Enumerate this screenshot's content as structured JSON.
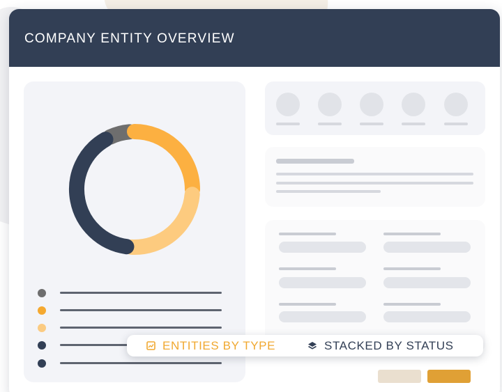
{
  "header": {
    "title": "COMPANY ENTITY OVERVIEW"
  },
  "chart": {
    "segments": [
      {
        "color": "#6e6e6e",
        "start_deg": 335,
        "end_deg": 355
      },
      {
        "color": "#fcb041",
        "start_deg": 0,
        "end_deg": 90
      },
      {
        "color": "#fdcb7f",
        "start_deg": 95,
        "end_deg": 183
      },
      {
        "color": "#323f55",
        "start_deg": 188,
        "end_deg": 330
      }
    ],
    "legend_colors": [
      "#6e6e6e",
      "#f5a930",
      "#fbcb82",
      "#323f55",
      "#323f55"
    ]
  },
  "tabs": [
    {
      "label": "ENTITIES BY TYPE",
      "icon": "chart-icon",
      "color": "#f0a830"
    },
    {
      "label": "STACKED BY STATUS",
      "icon": "layers-icon",
      "color": "#323f55"
    }
  ],
  "colors": {
    "header": "#323f55",
    "accent": "#e0a035",
    "panel": "#f3f4f8"
  }
}
